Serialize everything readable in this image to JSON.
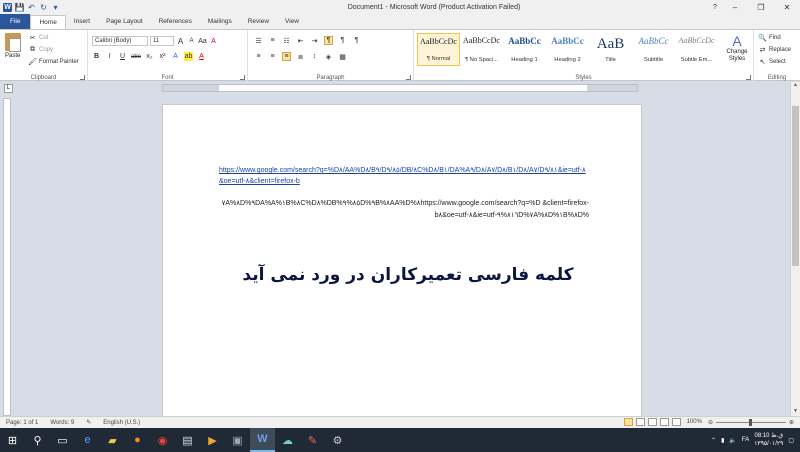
{
  "window": {
    "title": "Document1 - Microsoft Word (Product Activation Failed)",
    "help_label": "?",
    "minimize": "–",
    "restore": "❐",
    "close": "✕"
  },
  "qat": {
    "save": "💾",
    "undo": "↶",
    "redo": "↻",
    "more": "▾"
  },
  "tabs": [
    "File",
    "Home",
    "Insert",
    "Page Layout",
    "References",
    "Mailings",
    "Review",
    "View"
  ],
  "ribbon": {
    "clipboard": {
      "paste": "Paste",
      "cut": "Cut",
      "copy": "Copy",
      "format_painter": "Format Painter",
      "label": "Clipboard"
    },
    "font": {
      "name": "Calibri (Body)",
      "size": "11",
      "label": "Font",
      "grow": "A",
      "shrink": "A",
      "case": "Aa",
      "clear": "A",
      "bold": "B",
      "italic": "I",
      "underline": "U",
      "strike": "abe",
      "sub": "x₂",
      "sup": "x²",
      "effects": "A",
      "highlight": "ab",
      "color": "A"
    },
    "paragraph": {
      "label": "Paragraph",
      "pilcrow": "¶"
    },
    "styles": {
      "label": "Styles",
      "items": [
        {
          "sample": "AaBbCcDc",
          "name": "¶ Normal"
        },
        {
          "sample": "AaBbCcDc",
          "name": "¶ No Spaci..."
        },
        {
          "sample": "AaBbCc",
          "name": "Heading 1"
        },
        {
          "sample": "AaBbCc",
          "name": "Heading 2"
        },
        {
          "sample": "AaB",
          "name": "Title"
        },
        {
          "sample": "AaBbCc",
          "name": "Subtitle"
        },
        {
          "sample": "AaBbCcDc",
          "name": "Subtle Em..."
        }
      ],
      "change_styles": "Change Styles"
    },
    "editing": {
      "label": "Editing",
      "find": "Find",
      "replace": "Replace",
      "select": "Select"
    }
  },
  "document": {
    "link_text": "https://www.google.com/search?q=%D٨/AA%D٨/B٩/D٩/٨٥/DB/٨C%D٨/B١/DA%A٩/D٨/A٧/D٨/B١/D٨/A٧/D٩/٨١&ie=utf-٨&oe=utf-٨&client=firefox-b",
    "rtl_text": "٧A%٨D%٩DA%A%١B%٨C%D٨%DB%٨٥%٩D%٩B%٨AA%D%٨https://www.google.com/search?q=%D &client=firefox-b٨&oe=utf-٨&ie=utf-٨١٦%٩D%٧A%٨D%١B%٨D%",
    "heading": "کلمه فارسی تعمیرکاران در ورد نمی آید"
  },
  "status": {
    "page": "Page: 1 of 1",
    "words": "Words: 9",
    "language": "English (U.S.)",
    "zoom": "100%",
    "zoom_level": 100
  },
  "taskbar": {
    "time": "08:10 ق.ظ",
    "date": "۱۳۹۵/۰۱/۲۹",
    "lang": "FA"
  }
}
